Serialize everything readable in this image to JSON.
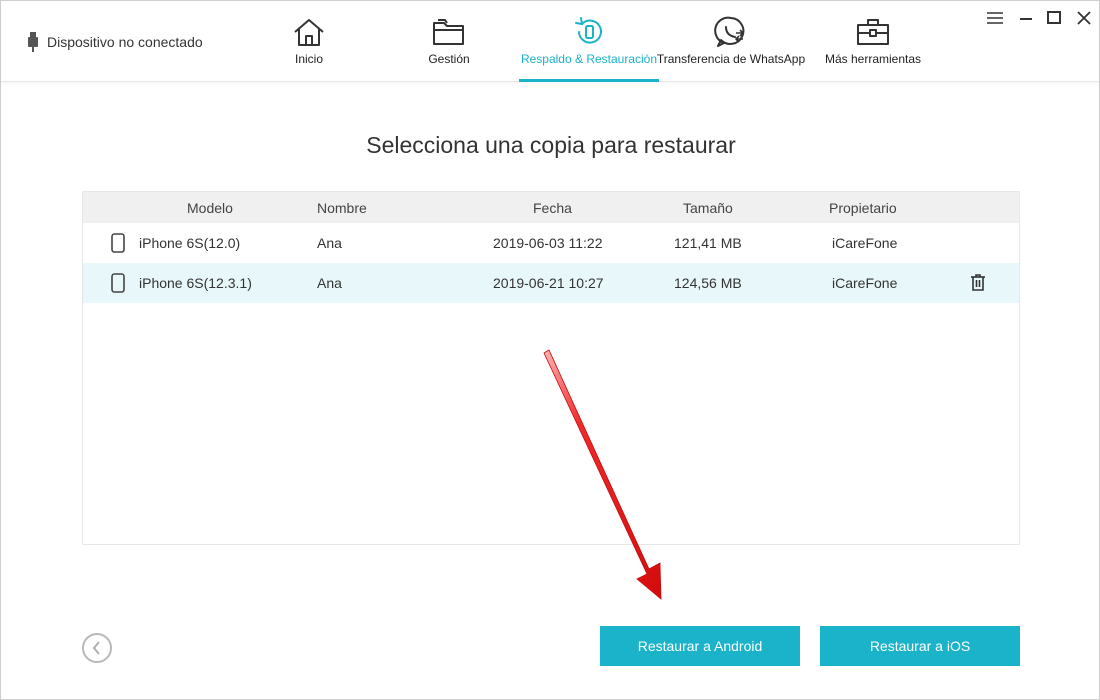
{
  "header": {
    "device_status": "Dispositivo no conectado",
    "nav": [
      {
        "label": "Inicio",
        "icon": "home-icon"
      },
      {
        "label": "Gestión",
        "icon": "folder-icon"
      },
      {
        "label": "Respaldo & Restauración",
        "icon": "backup-restore-icon",
        "active": true
      },
      {
        "label": "Transferencia de WhatsApp",
        "icon": "whatsapp-icon"
      },
      {
        "label": "Más herramientas",
        "icon": "toolbox-icon"
      }
    ],
    "window_controls": [
      "menu-icon",
      "minimize-icon",
      "maximize-icon",
      "close-icon"
    ]
  },
  "main": {
    "title": "Selecciona una copia para restaurar",
    "table": {
      "columns": [
        "Modelo",
        "Nombre",
        "Fecha",
        "Tamaño",
        "Propietario"
      ],
      "rows": [
        {
          "model": "iPhone 6S(12.0)",
          "name": "Ana",
          "date": "2019-06-03 11:22",
          "size": "121,41 MB",
          "owner": "iCareFone",
          "selected": false
        },
        {
          "model": "iPhone 6S(12.3.1)",
          "name": "Ana",
          "date": "2019-06-21 10:27",
          "size": "124,56 MB",
          "owner": "iCareFone",
          "selected": true
        }
      ]
    }
  },
  "footer": {
    "restore_android": "Restaurar a Android",
    "restore_ios": "Restaurar a iOS"
  },
  "colors": {
    "accent": "#1ab3c9",
    "selected_row": "#e8f7f9",
    "header_bg": "#f0f0f0",
    "annotation_arrow": "#e01010"
  }
}
